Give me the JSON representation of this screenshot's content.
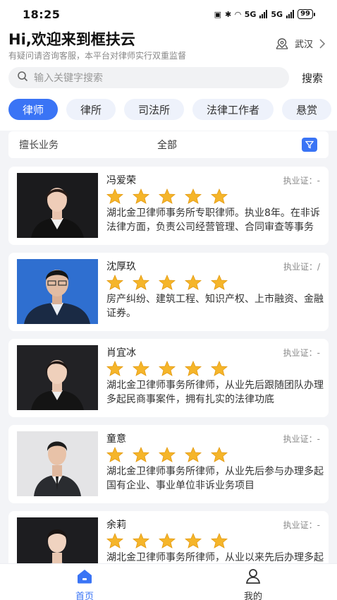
{
  "status_bar": {
    "time": "18:25",
    "network_1": "5G",
    "network_2": "5G",
    "battery": "99"
  },
  "header": {
    "greeting": "Hi,欢迎来到框扶云",
    "subtitle": "有疑问请咨询客服，本平台对律师实行双重监督",
    "location": "武汉"
  },
  "search": {
    "placeholder": "输入关键字搜索",
    "button": "搜索"
  },
  "tabs": [
    {
      "label": "律师",
      "active": true
    },
    {
      "label": "律所",
      "active": false
    },
    {
      "label": "司法所",
      "active": false
    },
    {
      "label": "法律工作者",
      "active": false
    },
    {
      "label": "悬赏",
      "active": false
    }
  ],
  "filter": {
    "label": "擅长业务",
    "value": "全部"
  },
  "lawyers": [
    {
      "name": "冯爱荣",
      "license": "执业证：-",
      "rating": 5,
      "desc": "湖北金卫律师事务所专职律师。执业8年。在非诉法律方面，负责公司经营管理、合同审查等事务"
    },
    {
      "name": "沈厚玖",
      "license": "执业证：/",
      "rating": 5,
      "desc": "房产纠纷、建筑工程、知识产权、上市融资、金融证券。"
    },
    {
      "name": "肖宜冰",
      "license": "执业证：-",
      "rating": 5,
      "desc": "湖北金卫律师事务所律师，从业先后跟随团队办理多起民商事案件，拥有扎实的法律功底"
    },
    {
      "name": "童意",
      "license": "执业证：-",
      "rating": 5,
      "desc": "湖北金卫律师事务所律师，从业先后参与办理多起国有企业、事业单位非诉业务项目"
    },
    {
      "name": "余莉",
      "license": "执业证：-",
      "rating": 5,
      "desc": "湖北金卫律师事务所律师，从业以来先后办理多起案件"
    }
  ],
  "nav": {
    "home": "首页",
    "mine": "我的"
  },
  "colors": {
    "accent": "#3a74f5",
    "star": "#f5b52a"
  }
}
